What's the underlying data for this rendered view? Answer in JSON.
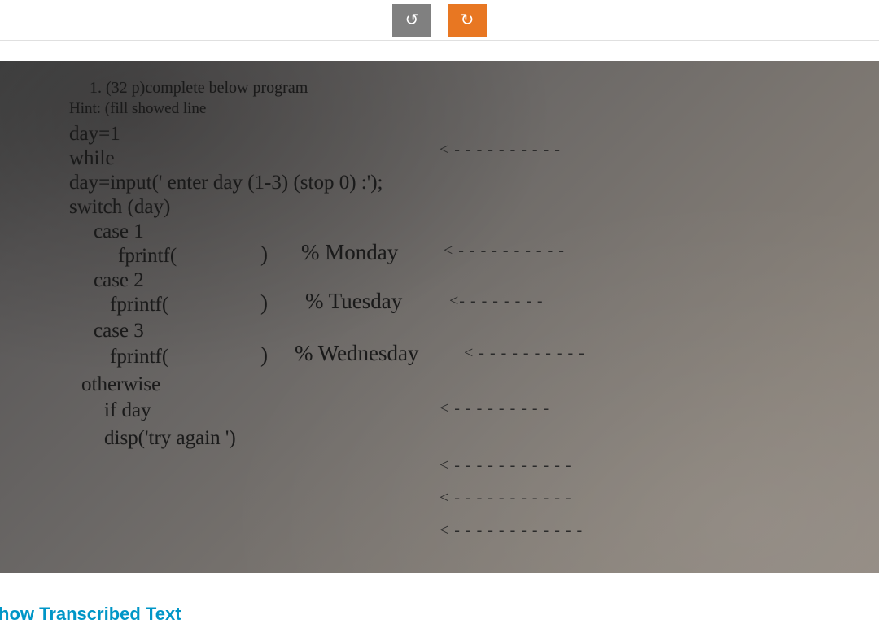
{
  "toolbar": {
    "rotate_left_icon": "↺",
    "rotate_right_icon": "↻"
  },
  "photo": {
    "lines": {
      "title": "1.   (32 p)complete below program",
      "hint": "Hint:  (fill showed line",
      "l1": "day=1",
      "l2": "while",
      "l3": "day=input(' enter day (1-3) (stop 0)  :');",
      "l4": "switch (day)",
      "l5": "case 1",
      "l6": "fprintf(",
      "l6b": ")",
      "l6c": "% Monday",
      "l7": "case 2",
      "l8": "fprintf(",
      "l8b": ")",
      "l8c": "% Tuesday",
      "l9": "case 3",
      "l10": "fprintf(",
      "l10b": ")",
      "l10c": "% Wednesday",
      "l11": "otherwise",
      "l12": "if day",
      "l13": "disp('try again ')"
    },
    "arrows": {
      "a1": "< - - - - - - - - - -",
      "a2": "< - - - - - - - - - -",
      "a3": "<- - - - - - - -",
      "a4": "< - - - - - - - - - -",
      "a5": "< - - - - - - - - -",
      "a6": "< - - - - - - - - - - -",
      "a7": "< - - - - - - - - - - -",
      "a8": "< - - - - - - - - - - - -"
    }
  },
  "bottom": {
    "show_transcribed": "how Transcribed Text"
  }
}
